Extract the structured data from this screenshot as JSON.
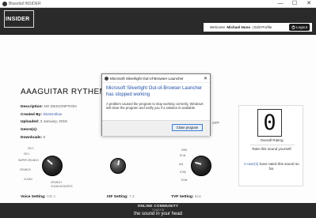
{
  "window": {
    "title": "Bluesfall INSIDER",
    "controls": [
      "—",
      "☐",
      "✕"
    ]
  },
  "header": {
    "logo_text": "INSIDER",
    "welcome_prefix": "Welcome",
    "username": "Michael Nuno",
    "separator": "|",
    "edit_profile": "Edit Profile",
    "logout_label": "Logout"
  },
  "preset": {
    "title": "AAAGUITAR RYTHEM",
    "description_label": "Description:",
    "description_value": "NO DESCRIPTION",
    "created_label": "Created By:",
    "created_value": "SkotHollow",
    "uploaded_label": "Uploaded:",
    "uploaded_value": "3 January, 2016",
    "genre_label": "Genre(s):",
    "genre_value": "",
    "downloads_label": "Downloads:",
    "downloads_value": "0",
    "off_text": "OFF"
  },
  "knobs": {
    "voice": {
      "labels_left": [
        "OD 2",
        "OD 1",
        "SUPER CRUNCH",
        "CRUNCH",
        "CLEAN"
      ],
      "labels_right": [
        "CRUNCH",
        "CLEAN ACOUSTIC"
      ],
      "setting_label": "Voice Setting:",
      "setting_value": "OD 1"
    },
    "isf": {
      "setting_label": "ISF Setting:",
      "setting_value": "7.2"
    },
    "tvp": {
      "labels_left": [
        "6766",
        "EL34",
        "6L6",
        "KT66",
        "EL84"
      ],
      "setting_label": "TVP Setting:",
      "setting_value": "6L6"
    }
  },
  "rating": {
    "digit": "0",
    "overall_label": "Overall Rating",
    "rate_text": "Rate this sound yourself",
    "users_count": "0 user(s)",
    "users_rest": "have rated this sound so far."
  },
  "footer": {
    "line1": "ONLINE COMMUNITY",
    "line2": "TONEFIB",
    "line3": "the sound in your head"
  },
  "dialog": {
    "title": "Microsoft Silverlight Out-of-Browser Launcher",
    "heading": "Microsoft Silverlight Out-of-Browser Launcher has stopped working",
    "body": "A problem caused the program to stop working correctly. Windows will close the program and notify you if a solution is available.",
    "close_button": "Close program"
  },
  "colors": {
    "accent": "#1f4fa8",
    "header_bg": "#2a2a2a",
    "footer_bg": "#2b2b2b"
  }
}
